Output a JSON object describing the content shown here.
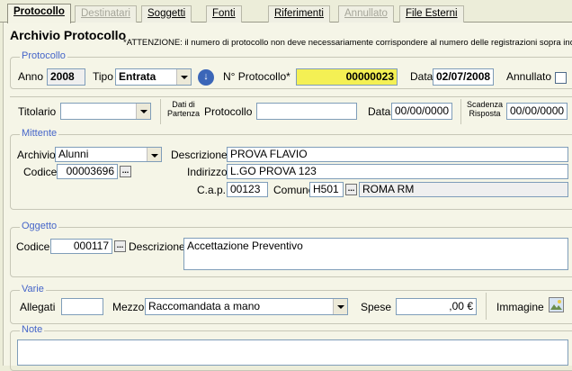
{
  "tabs": [
    {
      "label": "Protocollo",
      "active": true
    },
    {
      "label": "Destinatari",
      "disabled": true
    },
    {
      "label": "Soggetti"
    },
    {
      "label": "Fonti"
    },
    {
      "label": "Riferimenti"
    },
    {
      "label": "Annullato",
      "disabled": true
    },
    {
      "label": "File Esterni"
    }
  ],
  "header": {
    "title": "Archivio Protocollo",
    "notice": "*ATTENZIONE: il numero di protocollo non deve necessariamente corrispondere al numero delle registrazioni sopra indicato"
  },
  "protocollo": {
    "legend": "Protocollo",
    "anno_label": "Anno",
    "anno_value": "2008",
    "tipo_label": "Tipo",
    "tipo_value": "Entrata",
    "numero_label": "N° Protocollo*",
    "numero_value": "00000023",
    "data_label": "Data",
    "data_value": "02/07/2008",
    "annullato_label": "Annullato"
  },
  "partenza": {
    "titolario_label": "Titolario",
    "titolario_value": "",
    "dati_label_1": "Dati di",
    "dati_label_2": "Partenza",
    "protocollo_label": "Protocollo",
    "protocollo_value": "",
    "data_label": "Data",
    "data_value": "00/00/0000",
    "scadenza_label_1": "Scadenza",
    "scadenza_label_2": "Risposta",
    "scadenza_value": "00/00/0000"
  },
  "mittente": {
    "legend": "Mittente",
    "archivio_label": "Archivio",
    "archivio_value": "Alunni",
    "codice_label": "Codice",
    "codice_value": "00003696",
    "descrizione_label": "Descrizione",
    "descrizione_value": "PROVA  FLAVIO",
    "indirizzo_label": "Indirizzo",
    "indirizzo_value": "L.GO PROVA 123",
    "cap_label": "C.a.p.",
    "cap_value": "00123",
    "comune_label": "Comune",
    "comune_code": "H501",
    "comune_name": "ROMA  RM"
  },
  "oggetto": {
    "legend": "Oggetto",
    "codice_label": "Codice",
    "codice_value": "000117",
    "descrizione_label": "Descrizione",
    "descrizione_value": "Accettazione Preventivo"
  },
  "varie": {
    "legend": "Varie",
    "allegati_label": "Allegati",
    "allegati_value": "",
    "mezzo_label": "Mezzo",
    "mezzo_value": "Raccomandata a mano",
    "spese_label": "Spese",
    "spese_value": ",00 €",
    "immagine_label": "Immagine"
  },
  "note": {
    "legend": "Note",
    "value": ""
  },
  "ellipsis": "..."
}
